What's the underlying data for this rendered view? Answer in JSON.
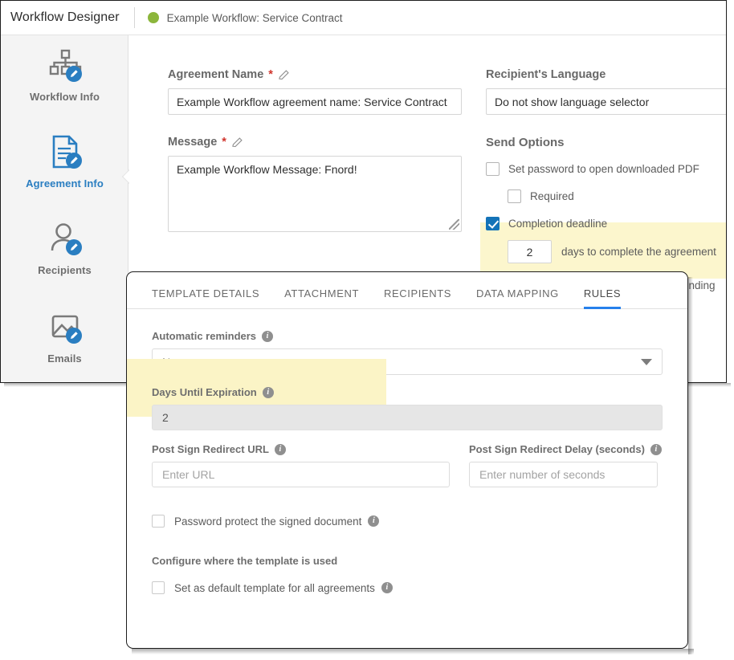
{
  "topbar": {
    "title": "Workflow Designer",
    "subtitle": "Example Workflow: Service Contract",
    "status_color": "#8cb63c"
  },
  "sidebar": {
    "items": [
      {
        "label": "Workflow Info",
        "icon": "org-chart-edit-icon",
        "active": false
      },
      {
        "label": "Agreement Info",
        "icon": "document-edit-icon",
        "active": true
      },
      {
        "label": "Recipients",
        "icon": "user-edit-icon",
        "active": false
      },
      {
        "label": "Emails",
        "icon": "image-mail-edit-icon",
        "active": false
      }
    ]
  },
  "form": {
    "agreement_name": {
      "label": "Agreement Name",
      "required_mark": "*",
      "value": "Example Workflow agreement name: Service Contract"
    },
    "message": {
      "label": "Message",
      "required_mark": "*",
      "value": "Example Workflow Message: Fnord!"
    },
    "recipients_language": {
      "label": "Recipient's Language",
      "value": "Do not show language selector"
    },
    "send_options": {
      "heading": "Send Options",
      "password_pdf": {
        "label": "Set password to open downloaded PDF",
        "checked": false
      },
      "required": {
        "label": "Required",
        "checked": false
      },
      "completion_deadline": {
        "label": "Completion deadline",
        "checked": true
      },
      "days_value": "2",
      "days_suffix": "days to complete the agreement",
      "tail_text": "ending",
      "highlight_color": "#fcf6cd"
    }
  },
  "dialog": {
    "tabs": [
      {
        "label": "TEMPLATE DETAILS",
        "active": false
      },
      {
        "label": "ATTACHMENT",
        "active": false
      },
      {
        "label": "RECIPIENTS",
        "active": false
      },
      {
        "label": "DATA MAPPING",
        "active": false
      },
      {
        "label": "RULES",
        "active": true
      }
    ],
    "active_tab_color": "#2680eb",
    "automatic_reminders": {
      "label": "Automatic reminders",
      "value": "Never"
    },
    "days_until_expiration": {
      "label": "Days Until Expiration",
      "value": "2",
      "disabled": true,
      "highlight_color": "#fbf4c6"
    },
    "post_sign_redirect_url": {
      "label": "Post Sign Redirect URL",
      "placeholder": "Enter URL",
      "value": ""
    },
    "post_sign_redirect_delay": {
      "label": "Post Sign Redirect Delay (seconds)",
      "placeholder": "Enter number of seconds",
      "value": ""
    },
    "password_protect": {
      "label": "Password protect the signed document",
      "checked": false
    },
    "configure_section_title": "Configure where the template is used",
    "set_default_template": {
      "label": "Set as default template for all agreements",
      "checked": false
    },
    "info_icon_glyph": "i"
  }
}
